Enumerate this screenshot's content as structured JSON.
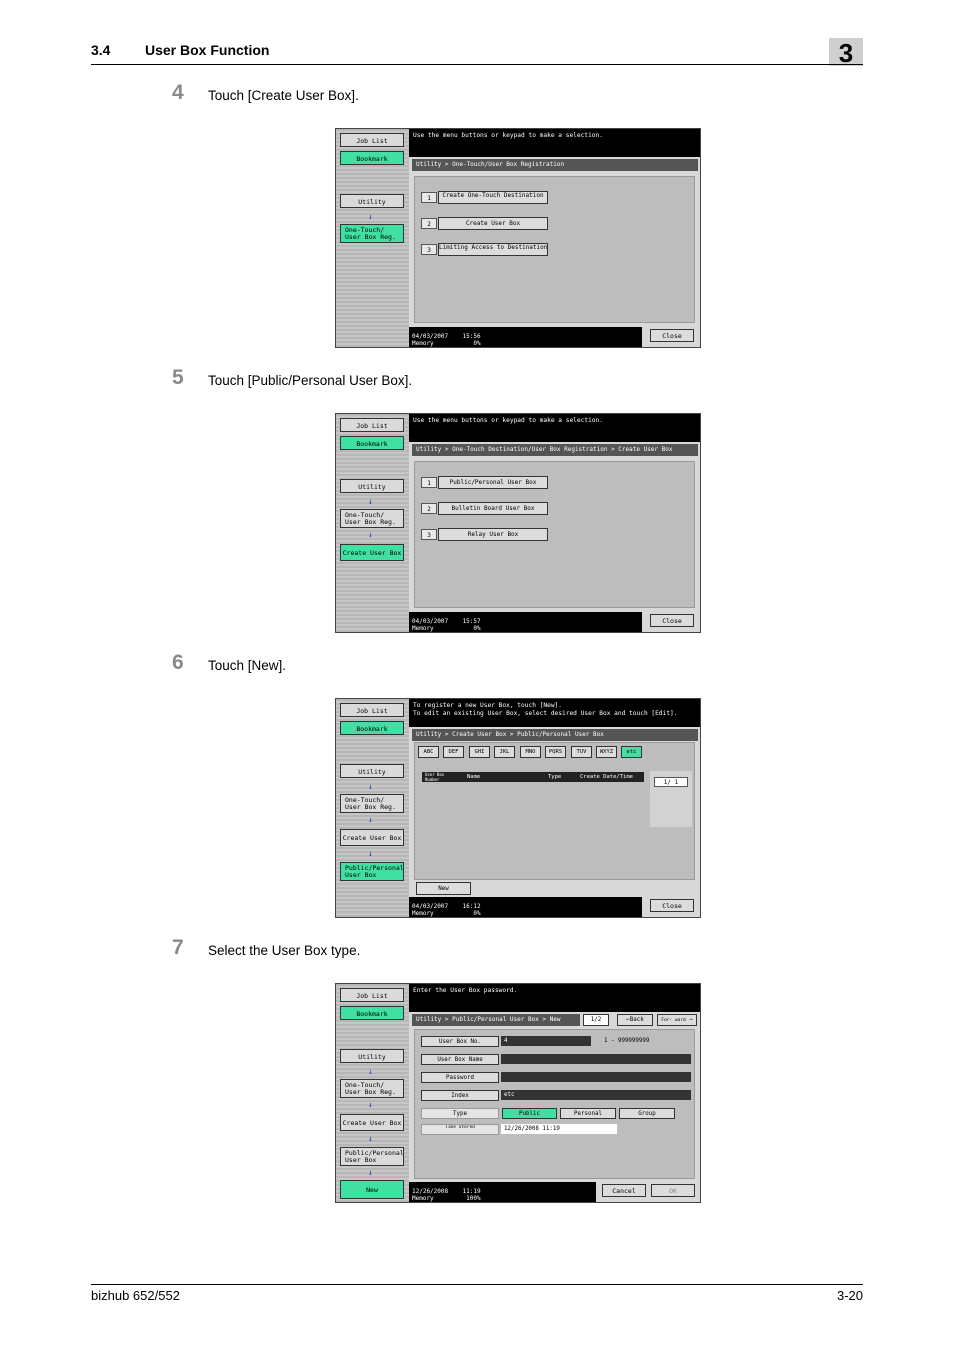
{
  "header": {
    "section_number": "3.4",
    "section_title": "User Box Function",
    "chapter": "3"
  },
  "steps": [
    {
      "number": "4",
      "text": "Touch [Create User Box]."
    },
    {
      "number": "5",
      "text": "Touch [Public/Personal User Box]."
    },
    {
      "number": "6",
      "text": "Touch [New]."
    },
    {
      "number": "7",
      "text": "Select the User Box type."
    }
  ],
  "footer": {
    "product": "bizhub 652/552",
    "page": "3-20"
  },
  "common": {
    "job_list": "Job List",
    "bookmark": "Bookmark",
    "utility": "Utility",
    "one_touch": "One-Touch/\nUser Box Reg.",
    "create_user_box": "Create User Box",
    "public_personal": "Public/Personal\nUser Box",
    "new": "New",
    "close": "Close",
    "arrow": "↓"
  },
  "screen1": {
    "message": "Use the menu buttons or keypad to make a selection.",
    "path": "Utility > One-Touch/User Box Registration",
    "items": [
      {
        "num": "1",
        "label": "Create One-Touch Destination"
      },
      {
        "num": "2",
        "label": "Create User Box"
      },
      {
        "num": "3",
        "label": "Limiting Access to Destinations"
      }
    ],
    "status": "04/03/2007    15:56\nMemory           0%"
  },
  "screen2": {
    "message": "Use the menu buttons or keypad to make a selection.",
    "path": "Utility > One-Touch Destination/User Box Registration > Create User Box",
    "items": [
      {
        "num": "1",
        "label": "Public/Personal User Box"
      },
      {
        "num": "2",
        "label": "Bulletin Board User Box"
      },
      {
        "num": "3",
        "label": "Relay User Box"
      }
    ],
    "status": "04/03/2007    15:57\nMemory           0%"
  },
  "screen3": {
    "message": "To register a new User Box, touch [New].\nTo edit an existing User Box, select desired User Box and touch [Edit].",
    "path": "Utility > Create User Box > Public/Personal User Box",
    "letters": [
      "ABC",
      "DEF",
      "GHI",
      "JKL",
      "MNO",
      "PQRS",
      "TUV",
      "WXYZ",
      "etc"
    ],
    "columns": [
      "User Box Number",
      "Name",
      "Type",
      "Create Date/Time"
    ],
    "pager": "1/  1",
    "status": "04/03/2007    16:12\nMemory           0%"
  },
  "screen4": {
    "message": "Enter the User Box password.",
    "path": "Utility > Public/Personal User Box > New",
    "page": "1/2",
    "back": "←Back",
    "forward": "For- ward",
    "forward_arrow": "→",
    "fields": {
      "user_box_no_label": "User Box No.",
      "user_box_no_value": "4",
      "range": "1 - 999999999",
      "name_label": "User Box Name",
      "password_label": "Password",
      "index_label": "Index",
      "index_value": "etc",
      "type_label": "Type",
      "type_public": "Public",
      "type_personal": "Personal",
      "type_group": "Group",
      "time_label": "Time Stored",
      "time_value": "12/26/2008    11:19"
    },
    "cancel": "Cancel",
    "ok": "OK",
    "status": "12/26/2008    11:19\nMemory         100%"
  },
  "colors": {
    "accent_green": "#3fe0a2",
    "arrow_blue": "#1b3fd4"
  }
}
